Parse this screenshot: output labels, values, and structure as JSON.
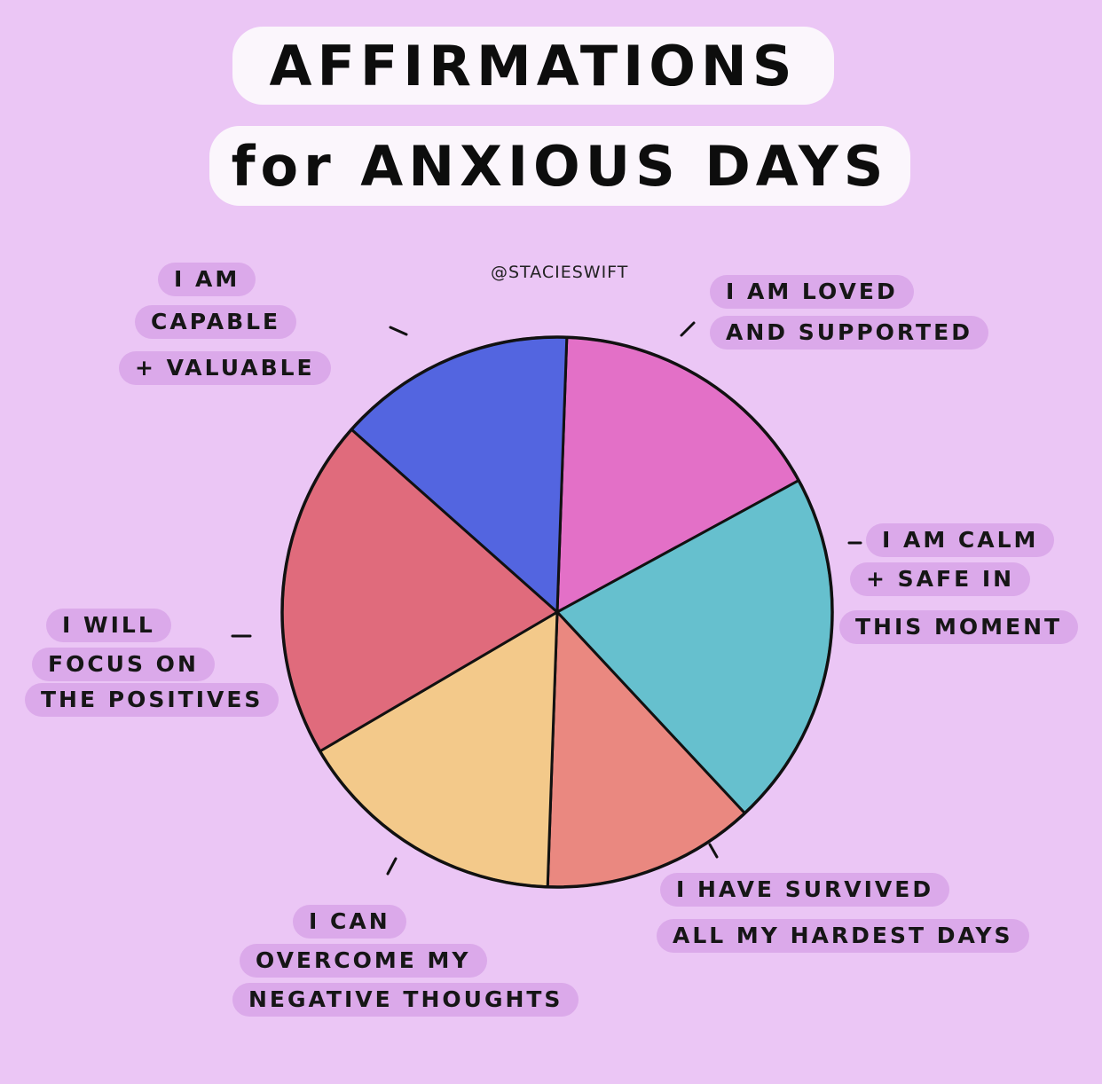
{
  "title": {
    "line1": "AFFIRMATIONS",
    "line2": "for ANXIOUS DAYS"
  },
  "credit": "@STACIESWIFT",
  "colors": {
    "background": "#ebc6f5",
    "label_highlight": "#dba9ea",
    "title_highlight": "#fbf6fc",
    "outline": "#111111"
  },
  "chart_data": {
    "type": "pie",
    "title": "AFFIRMATIONS for ANXIOUS DAYS",
    "slices": [
      {
        "label": "I AM LOVED AND SUPPORTED",
        "lines": [
          "I AM LOVED",
          "AND SUPPORTED"
        ],
        "value": 16.5,
        "color": "#e370c7"
      },
      {
        "label": "I AM CALM + SAFE IN THIS MOMENT",
        "lines": [
          "I AM CALM",
          "+ SAFE IN",
          "THIS MOMENT"
        ],
        "value": 21,
        "color": "#66c0ce"
      },
      {
        "label": "I HAVE SURVIVED ALL MY HARDEST DAYS",
        "lines": [
          "I HAVE SURVIVED",
          "ALL MY HARDEST DAYS"
        ],
        "value": 12.5,
        "color": "#ea8880"
      },
      {
        "label": "I CAN OVERCOME MY NEGATIVE THOUGHTS",
        "lines": [
          "I CAN",
          "OVERCOME MY",
          "NEGATIVE THOUGHTS"
        ],
        "value": 16,
        "color": "#f3c98a"
      },
      {
        "label": "I WILL FOCUS ON THE POSITIVES",
        "lines": [
          "I WILL",
          "FOCUS ON",
          "THE POSITIVES"
        ],
        "value": 20,
        "color": "#e06b7c"
      },
      {
        "label": "I AM CAPABLE + VALUABLE",
        "lines": [
          "I AM",
          "CAPABLE",
          "+ VALUABLE"
        ],
        "value": 14,
        "color": "#5365e0"
      }
    ]
  }
}
